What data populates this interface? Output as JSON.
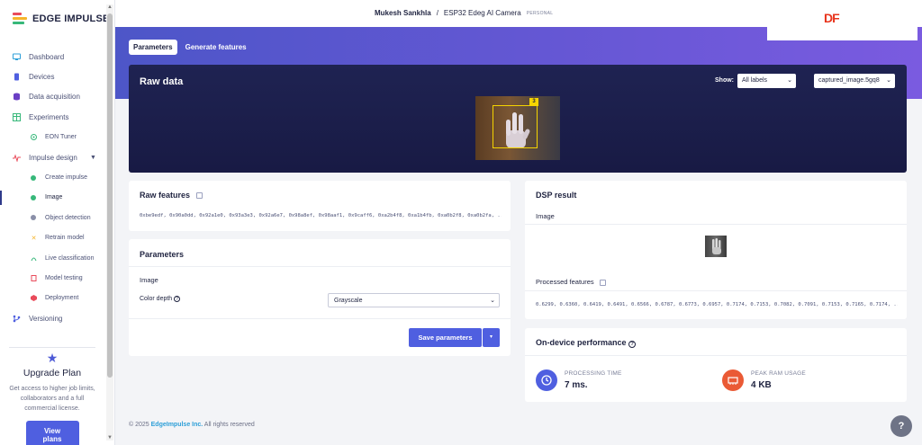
{
  "brand": {
    "name": "EDGE IMPULSE"
  },
  "sidebar": {
    "items": [
      {
        "label": "Dashboard",
        "icon": "monitor-icon"
      },
      {
        "label": "Devices",
        "icon": "devices-icon"
      },
      {
        "label": "Data acquisition",
        "icon": "database-icon"
      },
      {
        "label": "Experiments",
        "icon": "table-icon"
      },
      {
        "label": "EON Tuner",
        "icon": "tuner-icon"
      },
      {
        "label": "Impulse design",
        "icon": "pulse-icon"
      },
      {
        "label": "Create impulse",
        "icon": "dot-icon"
      },
      {
        "label": "Image",
        "icon": "dot-icon"
      },
      {
        "label": "Object detection",
        "icon": "dot-icon"
      },
      {
        "label": "Retrain model",
        "icon": "shuffle-icon"
      },
      {
        "label": "Live classification",
        "icon": "live-icon"
      },
      {
        "label": "Model testing",
        "icon": "clipboard-icon"
      },
      {
        "label": "Deployment",
        "icon": "box-icon"
      },
      {
        "label": "Versioning",
        "icon": "branch-icon"
      }
    ],
    "upgrade": {
      "title": "Upgrade Plan",
      "description": "Get access to higher job limits, collaborators and a full commercial license.",
      "button": "View plans"
    }
  },
  "header": {
    "user": "Mukesh Sankhla",
    "separator": "/",
    "project": "ESP32 Edeg AI Camera",
    "badge": "PERSONAL",
    "logo_text": "DF"
  },
  "tabs": [
    {
      "label": "Parameters",
      "active": true
    },
    {
      "label": "Generate features",
      "active": false
    }
  ],
  "raw_data": {
    "title": "Raw data",
    "show_label": "Show:",
    "label_filter": "All labels",
    "sample": "captured_image.5gq8",
    "box_label": "3"
  },
  "raw_features": {
    "title": "Raw features",
    "values": "0xbe9edf, 0x90a0dd, 0x92a1e0, 0x93a3e3, 0x92a6e7, 0x98a8ef, 0x98aaf1, 0x9caff6, 0xa2b4f8, 0xa1b4fb, 0xa0b2f8, 0xa0b2fa, ..."
  },
  "parameters": {
    "title": "Parameters",
    "section": "Image",
    "color_depth_label": "Color depth",
    "color_depth_value": "Grayscale",
    "save_button": "Save parameters"
  },
  "dsp_result": {
    "title": "DSP result",
    "image_label": "Image",
    "processed_title": "Processed features",
    "processed_values": "0.6299, 0.6360, 0.6419, 0.6491, 0.6566, 0.6787, 0.6773, 0.6957, 0.7174, 0.7153, 0.7082, 0.7091, 0.7153, 0.7165, 0.7174, ..."
  },
  "performance": {
    "title": "On-device performance",
    "processing_label": "PROCESSING TIME",
    "processing_value": "7 ms.",
    "ram_label": "PEAK RAM USAGE",
    "ram_value": "4 KB"
  },
  "footer": {
    "copyright": "© 2025",
    "company": "EdgeImpulse Inc.",
    "rights": "All rights reserved"
  },
  "colors": {
    "accent": "#4f5fe0",
    "banner_start": "#4d56c8",
    "banner_end": "#7a5be0",
    "dark_card": "#1c1f4a",
    "bbox": "#f5d400",
    "logo_red": "#e8341c"
  }
}
